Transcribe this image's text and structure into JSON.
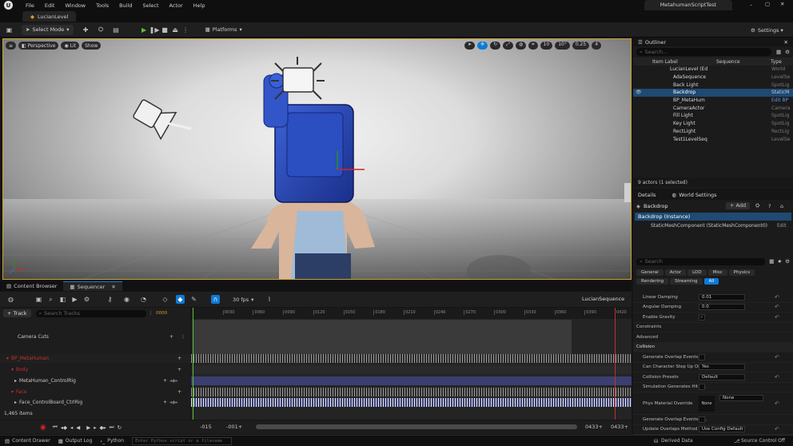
{
  "menubar": {
    "items": [
      "File",
      "Edit",
      "Window",
      "Tools",
      "Build",
      "Select",
      "Actor",
      "Help"
    ],
    "project": "MetahumanScriptTest"
  },
  "level_tab": "LucianLevel",
  "toolbar": {
    "select_mode": "Select Mode",
    "platforms": "Platforms",
    "settings": "Settings"
  },
  "viewport": {
    "perspective": "Perspective",
    "lit": "Lit",
    "show": "Show",
    "grid_snap": "10",
    "rot_snap": "10°",
    "scale_snap": "0.25",
    "cam_speed": "4"
  },
  "outliner": {
    "title": "Outliner",
    "search_placeholder": "Search...",
    "col_label": "Item Label",
    "col_sequence": "Sequence",
    "col_type": "Type",
    "rows": [
      {
        "label": "LucianLevel (Ed",
        "type": "World"
      },
      {
        "label": "AdaSequence",
        "type": "LevelSe"
      },
      {
        "label": "Back Light",
        "type": "SpotLig"
      },
      {
        "label": "Backdrop",
        "type": "StaticM"
      },
      {
        "label": "BP_MetaHum",
        "type": "Edit BP"
      },
      {
        "label": "CameraActor",
        "type": "Camera"
      },
      {
        "label": "Fill Light",
        "type": "SpotLig"
      },
      {
        "label": "Key Light",
        "type": "SpotLig"
      },
      {
        "label": "RectLight",
        "type": "RectLig"
      },
      {
        "label": "Test1LevelSeq",
        "type": "LevelSe"
      }
    ],
    "footer": "9 actors (1 selected)"
  },
  "details": {
    "tab": "Details",
    "tab2": "World Settings",
    "actor": "Backdrop",
    "add": "+ Add",
    "instance": "Backdrop (Instance)",
    "component": "StaticMeshComponent (StaticMeshComponent0)",
    "edit": "Edit",
    "search_placeholder": "Search",
    "cats_row1": [
      "General",
      "Actor",
      "LOD",
      "Misc",
      "Physics"
    ],
    "cats_row2": [
      "Rendering",
      "Streaming",
      "All"
    ],
    "props_a": [
      {
        "label": "Linear Damping",
        "value": "0.01"
      },
      {
        "label": "Angular Damping",
        "value": "0.0"
      },
      {
        "label": "Enable Gravity",
        "value": "✓"
      }
    ],
    "sec_constraints": "Constraints",
    "sec_advanced": "Advanced",
    "sec_collision": "Collision",
    "props_b": [
      {
        "label": "Generate Overlap Events",
        "value": ""
      },
      {
        "label": "Can Character Step Up On",
        "value": "Yes"
      },
      {
        "label": "Collision Presets",
        "value": "Default"
      },
      {
        "label": "Simulation Generates Hit E...",
        "value": ""
      },
      {
        "label": "Phys Material Override",
        "value": "None"
      },
      {
        "label": "Generate Overlap Events D...",
        "value": ""
      },
      {
        "label": "Update Overlaps Method D...",
        "value": "Use Config Default"
      }
    ],
    "phys_none": "None"
  },
  "sequencer": {
    "tab1": "Content Browser",
    "tab2": "Sequencer",
    "fps": "30 fps",
    "sequence": "LucianSequence",
    "add_track": "+ Track",
    "search_placeholder": "Search Tracks",
    "tracks": [
      "Camera Cuts",
      "BP_MetaHuman",
      "Body",
      "MetaHuman_ControlRig",
      "Face",
      "Face_ControlBoard_CtrlRig"
    ],
    "items_count": "1,465 items",
    "frame": "0000",
    "start": "-015",
    "start2": "-001+",
    "end": "0433+",
    "end2": "0433+",
    "ticks": [
      "0000",
      "0030",
      "0060",
      "0090",
      "0120",
      "0150",
      "0180",
      "0210",
      "0240",
      "0270",
      "0300",
      "0330",
      "0360",
      "0390",
      "0420"
    ]
  },
  "statusbar": {
    "content_drawer": "Content Drawer",
    "output_log": "Output Log",
    "python": "Python",
    "cmd_placeholder": "Enter Python script or a filename",
    "derived": "Derived Data",
    "source": "Source Control Off"
  },
  "colors": {
    "accent": "#0e7ad6",
    "selection": "#1f4a72",
    "seq_red": "#c23030",
    "sky": "#e8e8e8"
  }
}
